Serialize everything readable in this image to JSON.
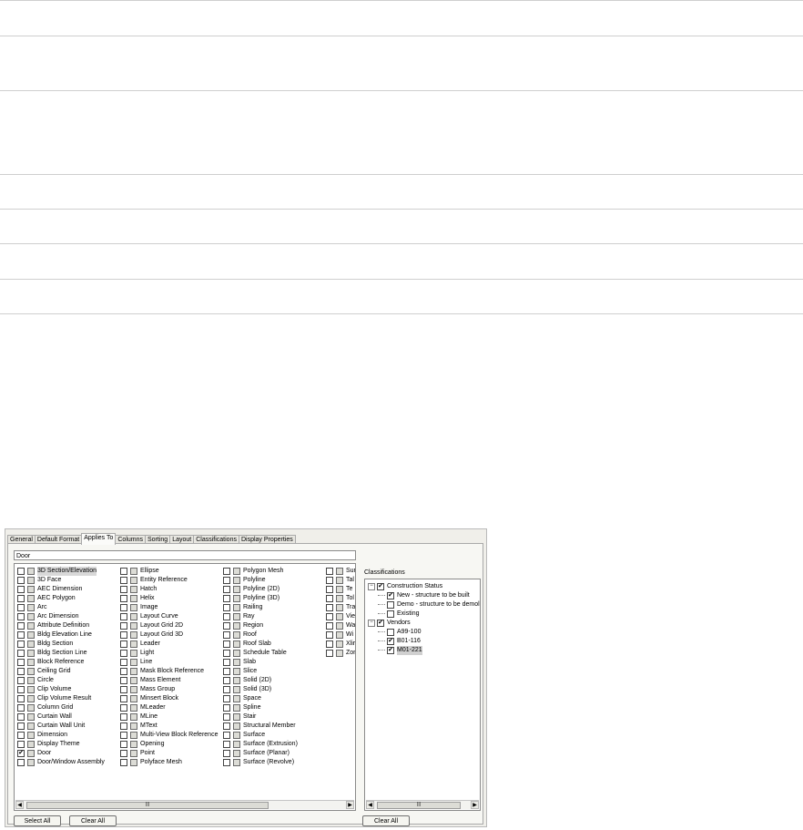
{
  "dialog": {
    "tabs": [
      "General",
      "Default Format",
      "Applies To",
      "Columns",
      "Sorting",
      "Layout",
      "Classifications",
      "Display Properties"
    ],
    "active_tab": "Applies To",
    "search_value": "Door",
    "objects": [
      [
        {
          "label": "3D Section/Elevation",
          "checked": false,
          "selected": true
        },
        {
          "label": "3D Face",
          "checked": false
        },
        {
          "label": "AEC Dimension",
          "checked": false
        },
        {
          "label": "AEC Polygon",
          "checked": false
        },
        {
          "label": "Arc",
          "checked": false
        },
        {
          "label": "Arc Dimension",
          "checked": false
        },
        {
          "label": "Attribute Definition",
          "checked": false
        },
        {
          "label": "Bldg Elevation Line",
          "checked": false
        },
        {
          "label": "Bldg Section",
          "checked": false
        },
        {
          "label": "Bldg Section Line",
          "checked": false
        },
        {
          "label": "Block Reference",
          "checked": false
        },
        {
          "label": "Ceiling Grid",
          "checked": false
        },
        {
          "label": "Circle",
          "checked": false
        },
        {
          "label": "Clip Volume",
          "checked": false
        },
        {
          "label": "Clip Volume Result",
          "checked": false
        },
        {
          "label": "Column Grid",
          "checked": false
        },
        {
          "label": "Curtain Wall",
          "checked": false
        },
        {
          "label": "Curtain Wall Unit",
          "checked": false
        },
        {
          "label": "Dimension",
          "checked": false
        },
        {
          "label": "Display Theme",
          "checked": false
        },
        {
          "label": "Door",
          "checked": true
        },
        {
          "label": "Door/Window Assembly",
          "checked": false
        }
      ],
      [
        {
          "label": "Ellipse",
          "checked": false
        },
        {
          "label": "Entity Reference",
          "checked": false
        },
        {
          "label": "Hatch",
          "checked": false
        },
        {
          "label": "Helix",
          "checked": false
        },
        {
          "label": "Image",
          "checked": false
        },
        {
          "label": "Layout Curve",
          "checked": false
        },
        {
          "label": "Layout Grid 2D",
          "checked": false
        },
        {
          "label": "Layout Grid 3D",
          "checked": false
        },
        {
          "label": "Leader",
          "checked": false
        },
        {
          "label": "Light",
          "checked": false
        },
        {
          "label": "Line",
          "checked": false
        },
        {
          "label": "Mask Block Reference",
          "checked": false
        },
        {
          "label": "Mass Element",
          "checked": false
        },
        {
          "label": "Mass Group",
          "checked": false
        },
        {
          "label": "Minsert Block",
          "checked": false
        },
        {
          "label": "MLeader",
          "checked": false
        },
        {
          "label": "MLine",
          "checked": false
        },
        {
          "label": "MText",
          "checked": false
        },
        {
          "label": "Multi-View Block Reference",
          "checked": false
        },
        {
          "label": "Opening",
          "checked": false
        },
        {
          "label": "Point",
          "checked": false
        },
        {
          "label": "Polyface Mesh",
          "checked": false
        }
      ],
      [
        {
          "label": "Polygon Mesh",
          "checked": false
        },
        {
          "label": "Polyline",
          "checked": false
        },
        {
          "label": "Polyline (2D)",
          "checked": false
        },
        {
          "label": "Polyline (3D)",
          "checked": false
        },
        {
          "label": "Railing",
          "checked": false
        },
        {
          "label": "Ray",
          "checked": false
        },
        {
          "label": "Region",
          "checked": false
        },
        {
          "label": "Roof",
          "checked": false
        },
        {
          "label": "Roof Slab",
          "checked": false
        },
        {
          "label": "Schedule Table",
          "checked": false
        },
        {
          "label": "Slab",
          "checked": false
        },
        {
          "label": "Slice",
          "checked": false
        },
        {
          "label": "Solid (2D)",
          "checked": false
        },
        {
          "label": "Solid (3D)",
          "checked": false
        },
        {
          "label": "Space",
          "checked": false
        },
        {
          "label": "Spline",
          "checked": false
        },
        {
          "label": "Stair",
          "checked": false
        },
        {
          "label": "Structural Member",
          "checked": false
        },
        {
          "label": "Surface",
          "checked": false
        },
        {
          "label": "Surface (Extrusion)",
          "checked": false
        },
        {
          "label": "Surface (Planar)",
          "checked": false
        },
        {
          "label": "Surface (Revolve)",
          "checked": false
        }
      ],
      [
        {
          "label": "Sur",
          "checked": false
        },
        {
          "label": "Tal",
          "checked": false
        },
        {
          "label": "Te",
          "checked": false
        },
        {
          "label": "Tol",
          "checked": false
        },
        {
          "label": "Tra",
          "checked": false
        },
        {
          "label": "Vie",
          "checked": false
        },
        {
          "label": "Wa",
          "checked": false
        },
        {
          "label": "Wi",
          "checked": false
        },
        {
          "label": "Xlir",
          "checked": false
        },
        {
          "label": "Zor",
          "checked": false
        }
      ]
    ],
    "classifications_label": "Classifications",
    "tree": [
      {
        "label": "Construction Status",
        "level": 0,
        "expander": "−",
        "checked": true
      },
      {
        "label": "New - structure to be built",
        "level": 1,
        "checked": true
      },
      {
        "label": "Demo - structure to be demolis",
        "level": 1,
        "checked": false
      },
      {
        "label": "Existing",
        "level": 1,
        "checked": false
      },
      {
        "label": "Vendors",
        "level": 0,
        "expander": "−",
        "checked": true
      },
      {
        "label": "A99-100",
        "level": 1,
        "checked": false
      },
      {
        "label": "B01-116",
        "level": 1,
        "checked": true
      },
      {
        "label": "M01-221",
        "level": 1,
        "checked": true,
        "selected": true
      }
    ],
    "select_all": "Select All",
    "clear_all": "Clear All",
    "clear_all_right": "Clear All"
  }
}
